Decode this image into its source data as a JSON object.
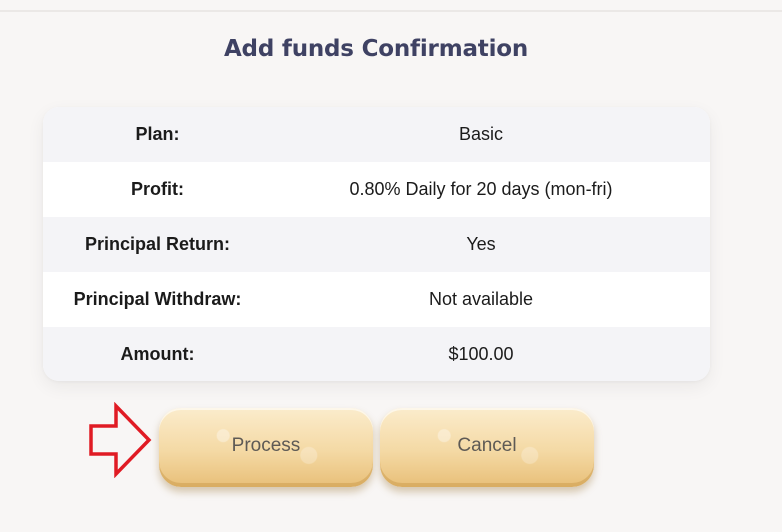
{
  "title": "Add funds Confirmation",
  "rows": [
    {
      "label": "Plan:",
      "value": "Basic"
    },
    {
      "label": "Profit:",
      "value": "0.80% Daily for 20 days (mon-fri)"
    },
    {
      "label": "Principal Return:",
      "value": "Yes"
    },
    {
      "label": "Principal Withdraw:",
      "value": "Not available"
    },
    {
      "label": "Amount:",
      "value": "$100.00"
    }
  ],
  "buttons": {
    "process_label": "Process",
    "cancel_label": "Cancel"
  },
  "colors": {
    "title": "#3f4263",
    "arrow": "#e01b24",
    "button_gold": "#f4d9a4"
  },
  "icons": {
    "pointer": "arrow-right-icon"
  }
}
